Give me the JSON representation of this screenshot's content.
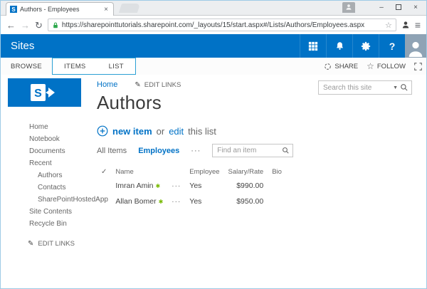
{
  "browser": {
    "tab_title": "Authors - Employees",
    "url": "https://sharepointtutorials.sharepoint.com/_layouts/15/start.aspx#/Lists/Authors/Employees.aspx"
  },
  "icons": {
    "back": "←",
    "forward": "→",
    "reload": "↻",
    "bookmark_star": "☆",
    "menu": "≡",
    "tab_close": "×",
    "minimize": "–",
    "close": "×",
    "help": "?",
    "pencil": "✎",
    "dropdown_arrow": "▼",
    "check": "✓",
    "new_burst": "✱",
    "ellipsis": "···",
    "follow_star": "☆",
    "sp_logo_letter": "S"
  },
  "suite_bar": {
    "title": "Sites"
  },
  "ribbon": {
    "tabs": {
      "browse": "BROWSE",
      "items": "ITEMS",
      "list": "LIST"
    },
    "share_label": "SHARE",
    "follow_label": "FOLLOW"
  },
  "sidebar": {
    "items": [
      {
        "label": "Home"
      },
      {
        "label": "Notebook"
      },
      {
        "label": "Documents"
      },
      {
        "label": "Recent"
      },
      {
        "label": "Authors"
      },
      {
        "label": "Contacts"
      },
      {
        "label": "SharePointHostedApp"
      },
      {
        "label": "Site Contents"
      },
      {
        "label": "Recycle Bin"
      }
    ],
    "edit_links": "EDIT LINKS"
  },
  "page": {
    "breadcrumb_home": "Home",
    "edit_links": "EDIT LINKS",
    "title": "Authors",
    "search_placeholder": "Search this site"
  },
  "command_bar": {
    "new_item": "new item",
    "or": "or",
    "edit": "edit",
    "this_list": "this list"
  },
  "views": {
    "all_items": "All Items",
    "employees": "Employees",
    "find_placeholder": "Find an item"
  },
  "table": {
    "headers": {
      "name": "Name",
      "employee": "Employee",
      "salary": "Salary/Rate",
      "bio": "Bio"
    },
    "rows": [
      {
        "name": "Imran Amin",
        "employee": "Yes",
        "salary": "$990.00",
        "bio": ""
      },
      {
        "name": "Allan Bomer",
        "employee": "Yes",
        "salary": "$950.00",
        "bio": ""
      }
    ]
  },
  "colors": {
    "accent_blue": "#0072c6",
    "new_burst_green": "#76b900",
    "contextual_tab_border": "#2ba0d4",
    "window_border": "#9ecbe6"
  }
}
